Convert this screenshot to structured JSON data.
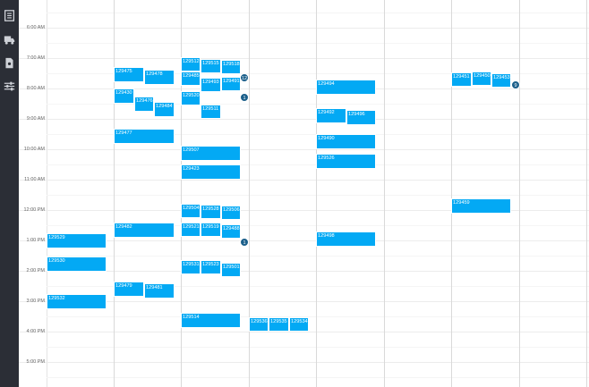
{
  "sidebar": {
    "items": [
      {
        "name": "list-icon"
      },
      {
        "name": "truck-icon"
      },
      {
        "name": "document-icon"
      },
      {
        "name": "sliders-icon"
      }
    ]
  },
  "times": [
    "6:00 AM",
    "7:00 AM",
    "8:00 AM",
    "9:00 AM",
    "10:00 AM",
    "11:00 AM",
    "12:00 PM",
    "1:00 PM",
    "2:00 PM",
    "3:00 PM",
    "4:00 PM",
    "5:00 PM"
  ],
  "events": [
    "129529",
    "129530",
    "129532",
    "129475",
    "129478",
    "129430",
    "129476",
    "129484",
    "129477",
    "129482",
    "129479",
    "129481",
    "129512",
    "129515",
    "129518",
    "129485",
    "129493",
    "129491",
    "129520",
    "129511",
    "129507",
    "129423",
    "129504",
    "129528",
    "129506",
    "129521",
    "129519",
    "129488",
    "129531",
    "129523",
    "129501",
    "129514",
    "129536",
    "129535",
    "129534",
    "129494",
    "129492",
    "129496",
    "129490",
    "129526",
    "129498",
    "129451",
    "129450",
    "129453",
    "129459"
  ],
  "badges": [
    "12",
    "1",
    "1",
    "9"
  ],
  "colors": {
    "event": "#03a9f4",
    "badge": "#1b5f8a",
    "sidebar": "#2b2e36"
  }
}
